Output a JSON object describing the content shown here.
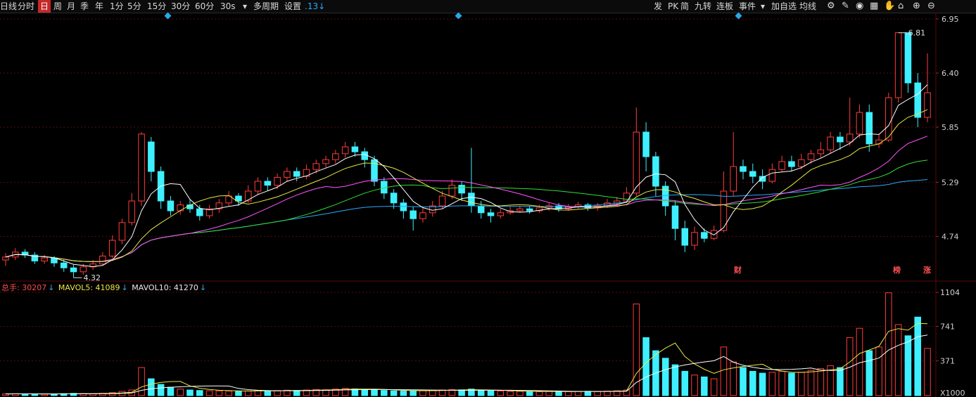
{
  "toolbar": {
    "left_items": [
      {
        "label": "日线",
        "active": false
      },
      {
        "label": "分时",
        "active": false
      },
      {
        "label": "日",
        "active": true
      },
      {
        "label": "周",
        "active": false
      },
      {
        "label": "月",
        "active": false
      },
      {
        "label": "季",
        "active": false
      },
      {
        "label": "年",
        "active": false
      },
      {
        "label": "1分",
        "active": false
      },
      {
        "label": "5分",
        "active": false
      },
      {
        "label": "15分",
        "active": false
      },
      {
        "label": "30分",
        "active": false
      },
      {
        "label": "60分",
        "active": false
      },
      {
        "label": "30s",
        "active": false
      },
      {
        "label": "▾",
        "active": false
      },
      {
        "label": "多周期",
        "active": false
      },
      {
        "label": "设置",
        "active": false
      },
      {
        "label": ".13↓",
        "active": false
      }
    ],
    "right_items": [
      "发",
      "PK",
      "简",
      "九转",
      "连板",
      "事件",
      "▾",
      "加自选",
      "均线",
      "⚙"
    ],
    "right_icons": [
      "gear-icon",
      "brush-icon",
      "eye-icon",
      "grid-icon",
      "hand-icon",
      "lock-icon",
      "zoom-in-icon",
      "zoom-out-icon"
    ],
    "right_icon_glyphs": [
      "⚙",
      "✎",
      "◉",
      "▦",
      "✋",
      "⌂",
      "⊕",
      "⊖"
    ]
  },
  "price_axis": [
    "6.95",
    "6.40",
    "5.85",
    "5.29",
    "4.74"
  ],
  "volume_axis": [
    "1104",
    "741",
    "371",
    "X1000"
  ],
  "annotations": {
    "high_label": "6.81",
    "low_label": "4.32",
    "tag_cai": "财",
    "tag_bang": "榜",
    "tag_zhang": "涨"
  },
  "volume_legend": {
    "total": "总手: 30207",
    "mavol5": "MAVOL5: 41089",
    "mavol10": "MAVOL10: 41270",
    "arrow": "↓"
  },
  "colors": {
    "up": "#ff3b3b",
    "down": "#3ef0ff",
    "ma5": "#ffffff",
    "ma10": "#e8e844",
    "ma20": "#ff55ff",
    "ma30": "#33dd33",
    "ma60": "#2aa9ff",
    "grid": "#5a0a0a",
    "accent": "#29a8e8"
  },
  "chart_data": {
    "type": "candlestick",
    "price_range": [
      4.32,
      6.95
    ],
    "volume_unit": "X1000",
    "volume_range": [
      0,
      1104
    ],
    "high": 6.81,
    "low": 4.32,
    "candles": [
      [
        4.5,
        4.53,
        4.44,
        4.57
      ],
      [
        4.53,
        4.58,
        4.5,
        4.62
      ],
      [
        4.58,
        4.55,
        4.52,
        4.61
      ],
      [
        4.55,
        4.49,
        4.46,
        4.58
      ],
      [
        4.49,
        4.52,
        4.46,
        4.55
      ],
      [
        4.52,
        4.47,
        4.43,
        4.54
      ],
      [
        4.47,
        4.42,
        4.38,
        4.5
      ],
      [
        4.42,
        4.38,
        4.32,
        4.45
      ],
      [
        4.38,
        4.43,
        4.35,
        4.46
      ],
      [
        4.43,
        4.46,
        4.4,
        4.5
      ],
      [
        4.46,
        4.54,
        4.44,
        4.58
      ],
      [
        4.54,
        4.7,
        4.52,
        4.75
      ],
      [
        4.7,
        4.88,
        4.66,
        4.92
      ],
      [
        4.88,
        5.1,
        4.85,
        5.18
      ],
      [
        5.1,
        5.78,
        5.05,
        5.8
      ],
      [
        5.7,
        5.4,
        5.3,
        5.75
      ],
      [
        5.4,
        5.1,
        5.02,
        5.45
      ],
      [
        5.1,
        5.0,
        4.95,
        5.15
      ],
      [
        5.0,
        5.06,
        4.96,
        5.1
      ],
      [
        5.06,
        5.02,
        4.98,
        5.12
      ],
      [
        5.02,
        4.95,
        4.9,
        5.06
      ],
      [
        4.95,
        5.02,
        4.92,
        5.06
      ],
      [
        5.02,
        5.08,
        4.98,
        5.12
      ],
      [
        5.08,
        5.15,
        5.05,
        5.2
      ],
      [
        5.15,
        5.1,
        5.05,
        5.18
      ],
      [
        5.1,
        5.2,
        5.08,
        5.26
      ],
      [
        5.2,
        5.3,
        5.16,
        5.34
      ],
      [
        5.3,
        5.26,
        5.2,
        5.34
      ],
      [
        5.26,
        5.34,
        5.22,
        5.38
      ],
      [
        5.34,
        5.4,
        5.3,
        5.44
      ],
      [
        5.4,
        5.35,
        5.3,
        5.44
      ],
      [
        5.35,
        5.42,
        5.32,
        5.47
      ],
      [
        5.42,
        5.48,
        5.38,
        5.52
      ],
      [
        5.48,
        5.52,
        5.44,
        5.56
      ],
      [
        5.52,
        5.58,
        5.48,
        5.62
      ],
      [
        5.58,
        5.65,
        5.54,
        5.7
      ],
      [
        5.65,
        5.6,
        5.55,
        5.7
      ],
      [
        5.6,
        5.52,
        5.44,
        5.64
      ],
      [
        5.52,
        5.3,
        5.25,
        5.56
      ],
      [
        5.3,
        5.18,
        5.12,
        5.34
      ],
      [
        5.18,
        5.08,
        5.02,
        5.22
      ],
      [
        5.08,
        5.0,
        4.92,
        5.12
      ],
      [
        5.0,
        4.92,
        4.8,
        5.04
      ],
      [
        4.92,
        4.98,
        4.88,
        5.04
      ],
      [
        4.98,
        5.05,
        4.94,
        5.1
      ],
      [
        5.05,
        5.15,
        5.02,
        5.2
      ],
      [
        5.15,
        5.26,
        5.12,
        5.32
      ],
      [
        5.26,
        5.18,
        5.1,
        5.3
      ],
      [
        5.18,
        5.05,
        4.98,
        5.64
      ],
      [
        5.05,
        4.98,
        4.92,
        5.1
      ],
      [
        4.98,
        4.95,
        4.88,
        5.02
      ],
      [
        4.95,
        4.98,
        4.92,
        5.02
      ],
      [
        4.98,
        5.0,
        4.96,
        5.04
      ],
      [
        5.0,
        5.02,
        4.98,
        5.05
      ],
      [
        5.02,
        5.0,
        4.97,
        5.05
      ],
      [
        5.0,
        5.03,
        4.98,
        5.06
      ],
      [
        5.03,
        5.05,
        5.0,
        5.08
      ],
      [
        5.05,
        5.02,
        4.99,
        5.08
      ],
      [
        5.02,
        5.04,
        5.0,
        5.07
      ],
      [
        5.04,
        5.06,
        5.02,
        5.09
      ],
      [
        5.06,
        5.03,
        5.0,
        5.08
      ],
      [
        5.03,
        5.05,
        5.0,
        5.08
      ],
      [
        5.05,
        5.08,
        5.03,
        5.12
      ],
      [
        5.08,
        5.1,
        5.05,
        5.14
      ],
      [
        5.1,
        5.18,
        5.08,
        5.24
      ],
      [
        5.18,
        5.8,
        5.15,
        6.05
      ],
      [
        5.8,
        5.55,
        5.4,
        5.9
      ],
      [
        5.55,
        5.25,
        5.15,
        5.6
      ],
      [
        5.25,
        5.05,
        4.95,
        5.3
      ],
      [
        5.05,
        4.82,
        4.7,
        5.1
      ],
      [
        4.82,
        4.65,
        4.58,
        4.9
      ],
      [
        4.65,
        4.78,
        4.6,
        4.84
      ],
      [
        4.78,
        4.72,
        4.68,
        4.82
      ],
      [
        4.72,
        4.8,
        4.7,
        4.85
      ],
      [
        4.8,
        5.2,
        4.78,
        5.4
      ],
      [
        5.2,
        5.45,
        5.15,
        5.8
      ],
      [
        5.45,
        5.4,
        5.32,
        5.52
      ],
      [
        5.4,
        5.35,
        5.28,
        5.48
      ],
      [
        5.35,
        5.3,
        5.22,
        5.42
      ],
      [
        5.3,
        5.42,
        5.28,
        5.48
      ],
      [
        5.42,
        5.5,
        5.4,
        5.56
      ],
      [
        5.5,
        5.45,
        5.4,
        5.56
      ],
      [
        5.45,
        5.52,
        5.42,
        5.58
      ],
      [
        5.52,
        5.58,
        5.48,
        5.62
      ],
      [
        5.58,
        5.62,
        5.54,
        5.7
      ],
      [
        5.62,
        5.75,
        5.58,
        5.8
      ],
      [
        5.75,
        5.7,
        5.62,
        5.8
      ],
      [
        5.7,
        5.78,
        5.66,
        6.15
      ],
      [
        5.78,
        6.0,
        5.74,
        6.08
      ],
      [
        6.0,
        5.68,
        5.6,
        6.08
      ],
      [
        5.68,
        5.72,
        5.64,
        5.78
      ],
      [
        5.72,
        6.15,
        5.7,
        6.2
      ],
      [
        6.15,
        6.81,
        6.1,
        6.81
      ],
      [
        6.81,
        6.3,
        6.2,
        6.81
      ],
      [
        6.3,
        5.95,
        5.85,
        6.4
      ],
      [
        5.95,
        6.2,
        5.9,
        6.6
      ]
    ],
    "volumes": [
      18,
      20,
      19,
      17,
      16,
      18,
      21,
      24,
      22,
      20,
      25,
      32,
      45,
      60,
      300,
      180,
      120,
      90,
      70,
      60,
      55,
      52,
      50,
      48,
      45,
      50,
      55,
      52,
      54,
      58,
      55,
      60,
      65,
      62,
      70,
      78,
      72,
      68,
      60,
      55,
      50,
      48,
      52,
      55,
      58,
      60,
      65,
      62,
      70,
      55,
      50,
      48,
      45,
      46,
      44,
      42,
      45,
      44,
      43,
      45,
      46,
      44,
      48,
      52,
      60,
      980,
      620,
      480,
      400,
      330,
      260,
      220,
      200,
      180,
      520,
      360,
      300,
      260,
      240,
      250,
      260,
      240,
      250,
      270,
      290,
      320,
      300,
      620,
      720,
      480,
      520,
      1100,
      760,
      640,
      840,
      505
    ],
    "ma_series": [
      "MA5",
      "MA10",
      "MA20",
      "MA30",
      "MA60"
    ]
  }
}
